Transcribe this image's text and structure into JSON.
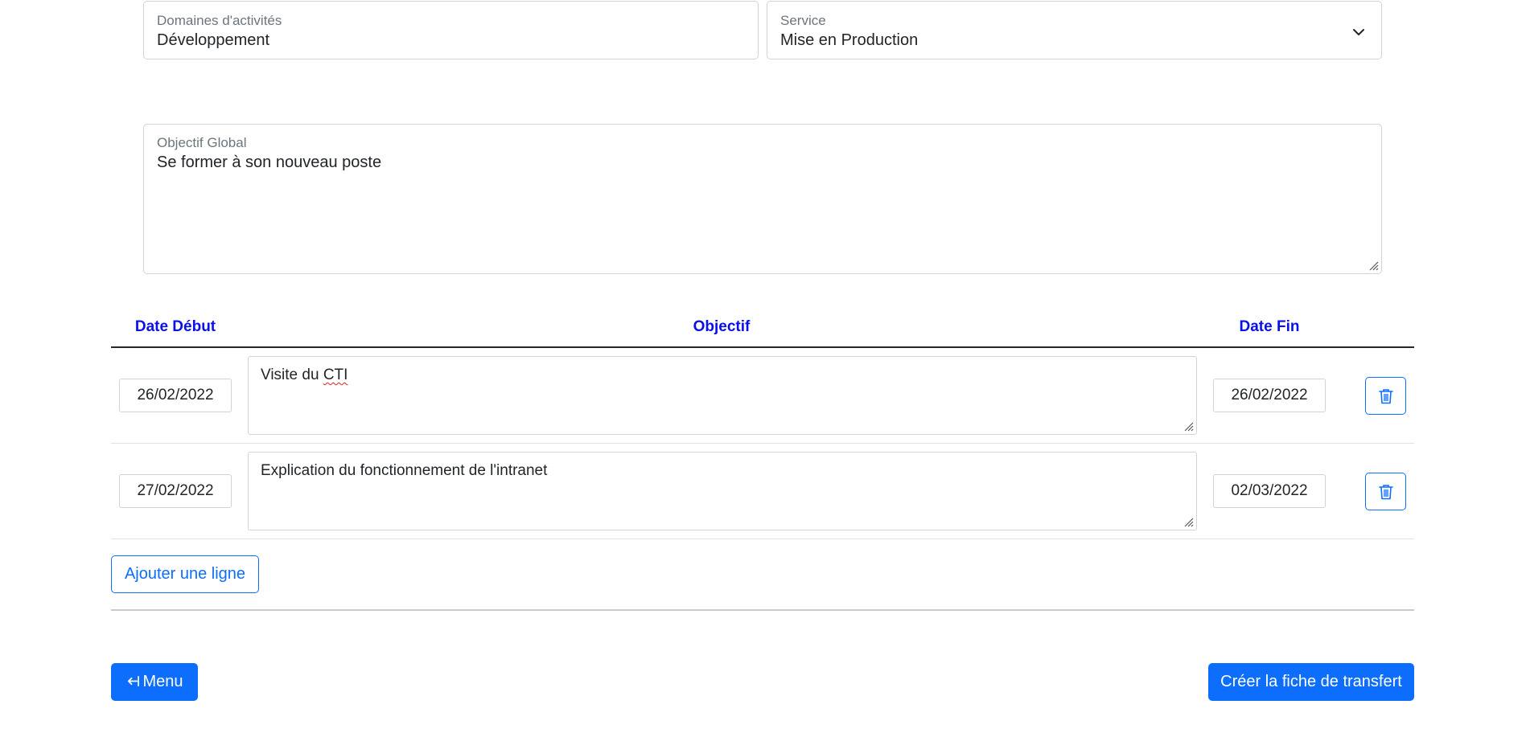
{
  "form": {
    "domain": {
      "label": "Domaines d'activités",
      "value": "Développement"
    },
    "service": {
      "label": "Service",
      "value": "Mise en Production"
    },
    "global_objective": {
      "label": "Objectif Global",
      "value": "Se former à son nouveau poste"
    }
  },
  "table": {
    "headers": {
      "start_date": "Date Début",
      "objective": "Objectif",
      "end_date": "Date Fin"
    },
    "rows": [
      {
        "start_date": "26/02/2022",
        "objective_prefix": "Visite du ",
        "objective_flagged": "CTI",
        "end_date": "26/02/2022"
      },
      {
        "start_date": "27/02/2022",
        "objective": "Explication du fonctionnement de l'intranet",
        "end_date": "02/03/2022"
      }
    ]
  },
  "actions": {
    "add_row_label": "Ajouter une ligne",
    "menu_label": "Menu",
    "create_label": "Créer la fiche de transfert"
  },
  "icons": {
    "chevron": "chevron-down-icon",
    "trash": "trash-icon",
    "menu": "arrow-left-to-bar-icon",
    "grip": "resize-grip-icon"
  },
  "colors": {
    "primary": "#0d6efd",
    "header_text": "#0a11e8",
    "border": "#ced4da"
  }
}
